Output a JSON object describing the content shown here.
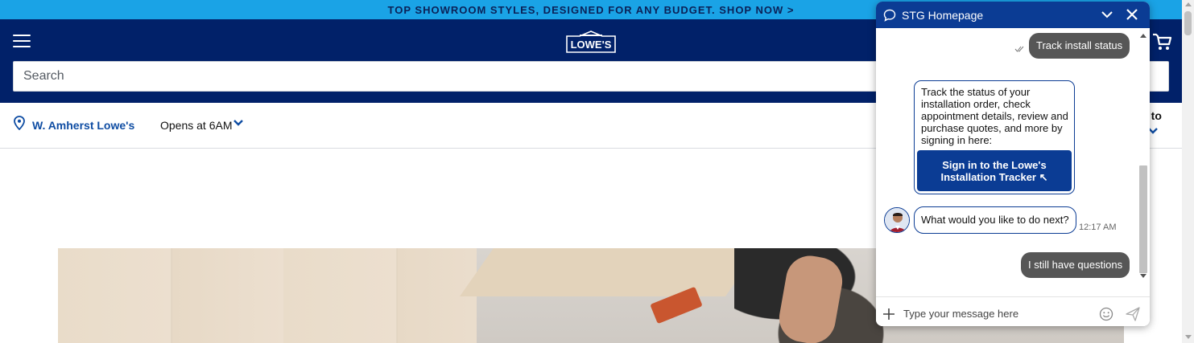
{
  "promo": {
    "text": "TOP SHOWROOM STYLES, DESIGNED FOR ANY BUDGET. SHOP NOW >"
  },
  "header": {
    "menu_icon": "hamburger-icon",
    "logo_text": "LOWE'S",
    "cart_icon": "cart-icon",
    "search": {
      "placeholder": "Search",
      "value": ""
    }
  },
  "store": {
    "pin_icon": "location-pin-icon",
    "name": "W. Amherst Lowe's",
    "hours": "Opens at 6AM",
    "deliver_label": "y to"
  },
  "chat": {
    "title": "STG Homepage",
    "title_icon": "chat-bubble-icon",
    "messages": {
      "user_first": "Track install status",
      "bot_card_text": "Track the status of your installation order, check appointment details, review and purchase quotes, and more by signing in here:",
      "bot_card_button": "Sign in to the Lowe's Installation Tracker ↖",
      "bot_question": "What would you like to do next?",
      "bot_question_time": "12:17 AM",
      "user_second": "I still have questions"
    },
    "input": {
      "placeholder": "Type your message here",
      "value": ""
    }
  },
  "colors": {
    "promo_bg": "#1aa3e6",
    "header_bg": "#012169",
    "chat_header_bg": "#0b3c94",
    "store_link": "#0f4da3",
    "user_bubble": "#565656"
  }
}
